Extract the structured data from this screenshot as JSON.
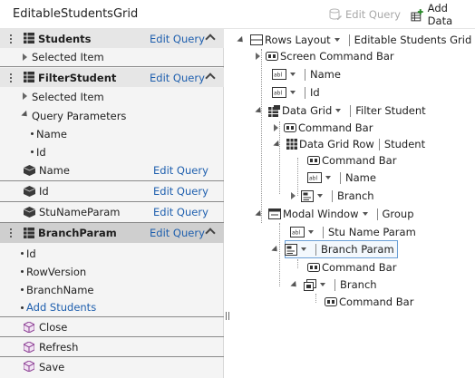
{
  "app": {
    "title": "EditableStudentsGrid"
  },
  "toolbar": {
    "edit_query": "Edit Query",
    "add_data": "Add Data"
  },
  "left_panel": {
    "sections": [
      {
        "name": "Students",
        "edit": "Edit Query"
      },
      {
        "name": "FilterStudent",
        "edit": "Edit Query"
      },
      {
        "name": "BranchParam",
        "edit": "Edit Query"
      }
    ],
    "selected_item": "Selected Item",
    "query_parameters": "Query Parameters",
    "params": [
      "Name",
      "Id"
    ],
    "properties": [
      {
        "name": "Name",
        "edit": "Edit Query"
      },
      {
        "name": "Id",
        "edit": "Edit Query"
      },
      {
        "name": "StuNameParam",
        "edit": "Edit Query"
      }
    ],
    "branch_fields": [
      "Id",
      "RowVersion",
      "BranchName"
    ],
    "add_students": "Add Students",
    "methods": [
      "Close",
      "Refresh",
      "Save"
    ]
  },
  "tree": {
    "root": {
      "control": "Rows Layout",
      "label": "Editable Students Grid"
    },
    "screen_command_bar": "Screen Command Bar",
    "name": "Name",
    "id": "Id",
    "data_grid": {
      "control": "Data Grid",
      "label": "Filter Student"
    },
    "command_bar": "Command Bar",
    "data_grid_row": {
      "control": "Data Grid Row",
      "label": "Student"
    },
    "row_command_bar": "Command Bar",
    "row_name": "Name",
    "row_branch": "Branch",
    "modal": {
      "control": "Modal Window",
      "label": "Group"
    },
    "stu_name_param": "Stu Name Param",
    "branch_param": "Branch Param",
    "bp_command_bar": "Command Bar",
    "branch": "Branch",
    "branch_command_bar": "Command Bar"
  }
}
